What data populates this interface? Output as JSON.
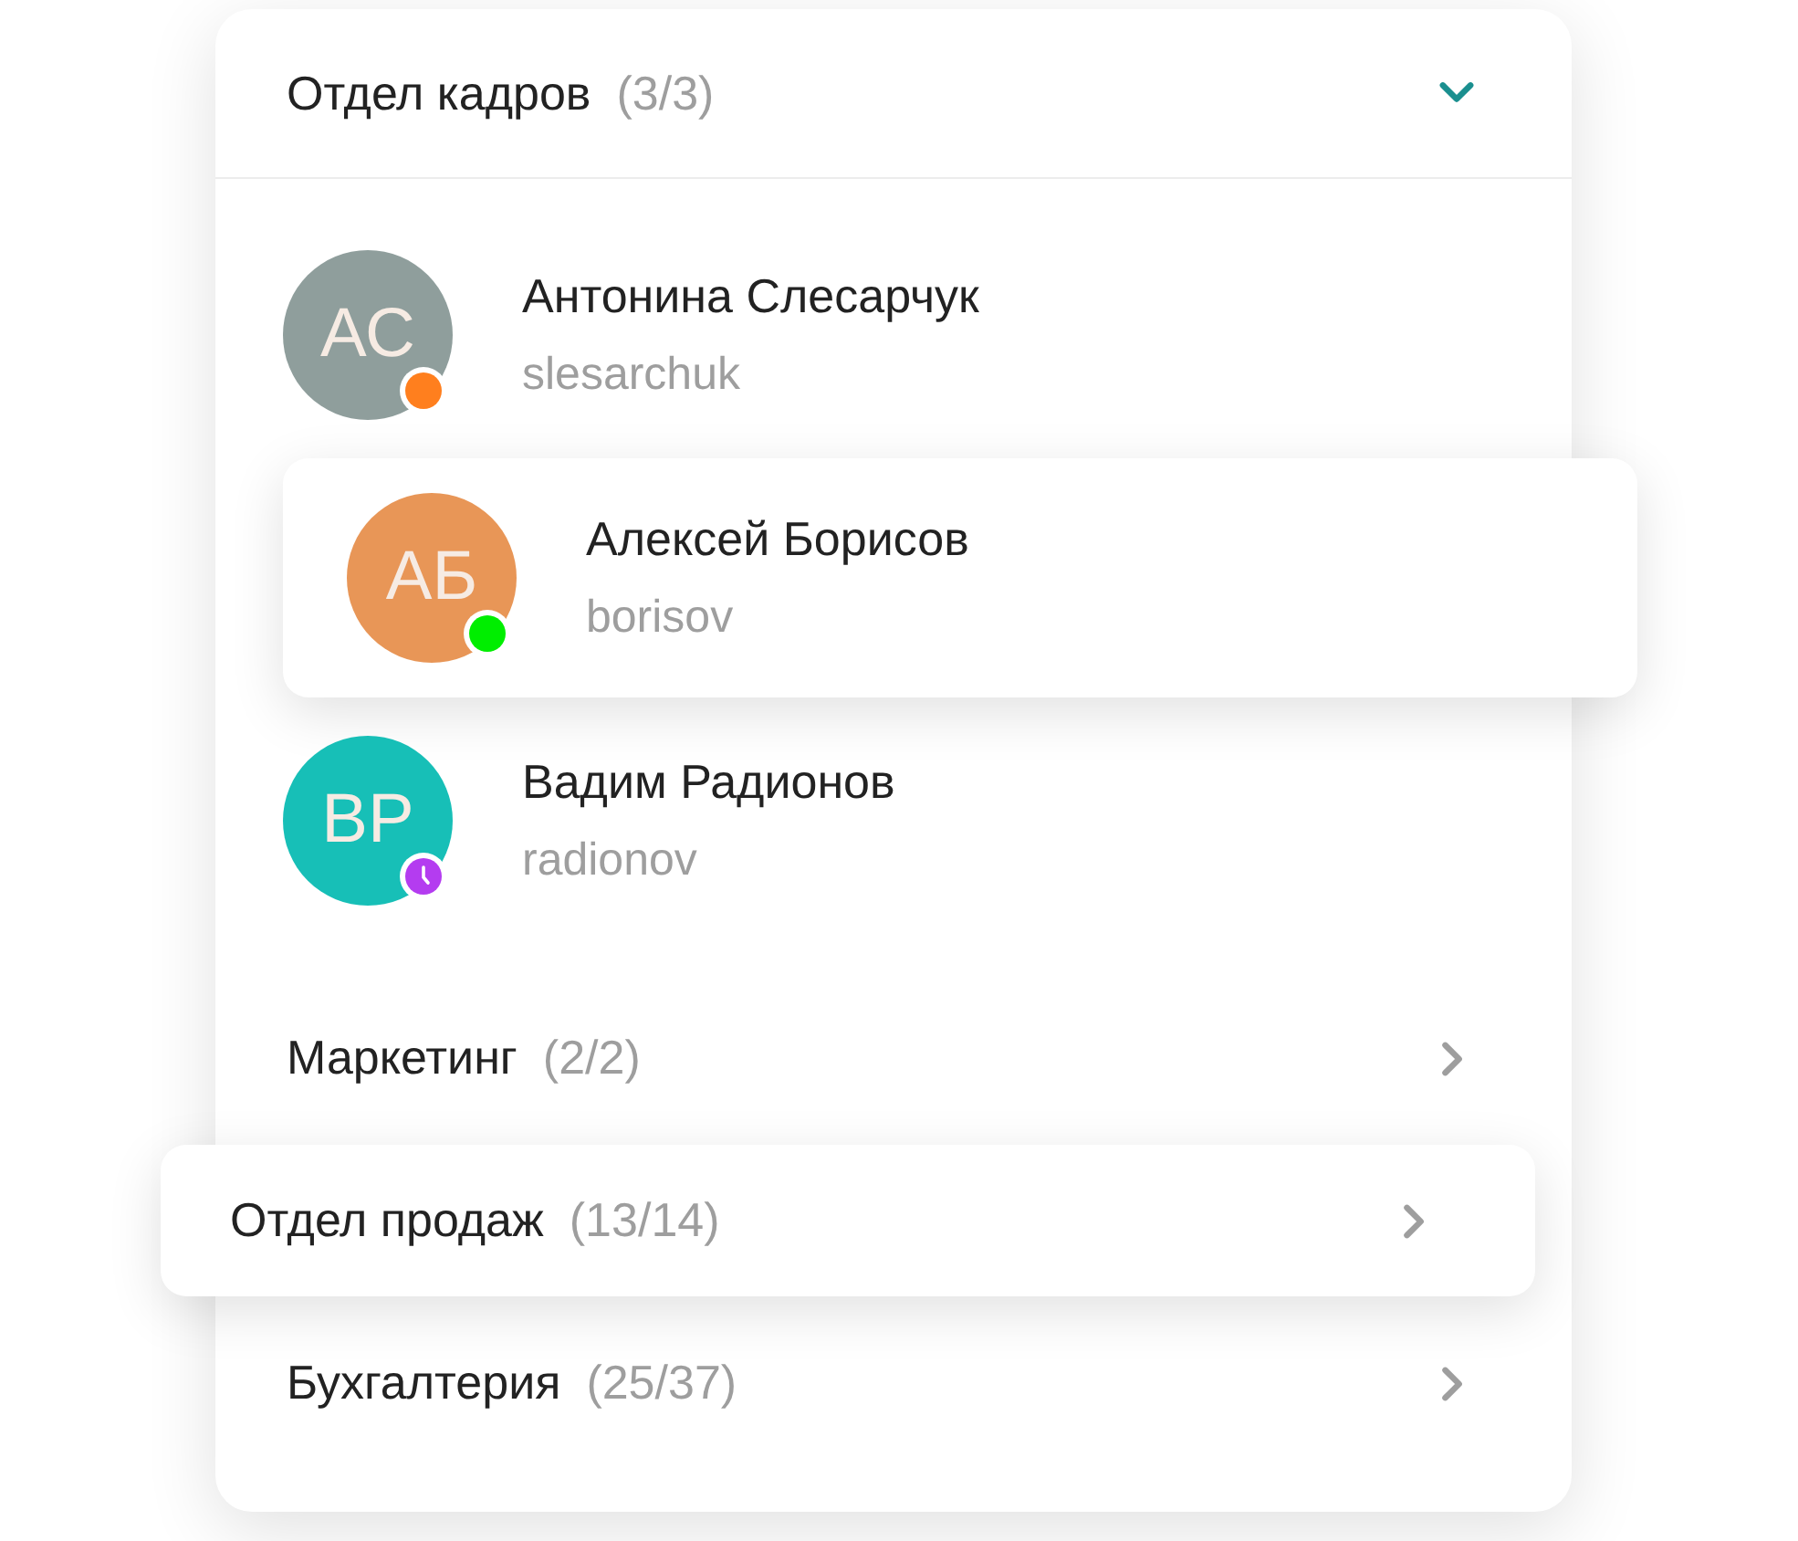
{
  "department": {
    "title": "Отдел кадров",
    "count": "(3/3)",
    "expanded": true
  },
  "members": [
    {
      "initials": "АС",
      "name": "Антонина Слесарчук",
      "username": "slesarchuk",
      "color": "#8f9e9c",
      "selected": false,
      "status": {
        "kind": "dot",
        "color": "#ff7f1e"
      }
    },
    {
      "initials": "АБ",
      "name": "Алексей Борисов",
      "username": "borisov",
      "color": "#e89657",
      "selected": true,
      "status": {
        "kind": "dot",
        "color": "#00ee00"
      }
    },
    {
      "initials": "ВР",
      "name": "Вадим Радионов",
      "username": "radionov",
      "color": "#17bfb7",
      "selected": false,
      "status": {
        "kind": "clock",
        "color": "#b43cf0"
      }
    }
  ],
  "groups": [
    {
      "name": "Маркетинг",
      "count": "(2/2)",
      "expanded": false,
      "selected": false
    },
    {
      "name": "Отдел продаж",
      "count": "(13/14)",
      "expanded": false,
      "selected": true
    },
    {
      "name": "Бухгалтерия",
      "count": "(25/37)",
      "expanded": false,
      "selected": false
    }
  ]
}
